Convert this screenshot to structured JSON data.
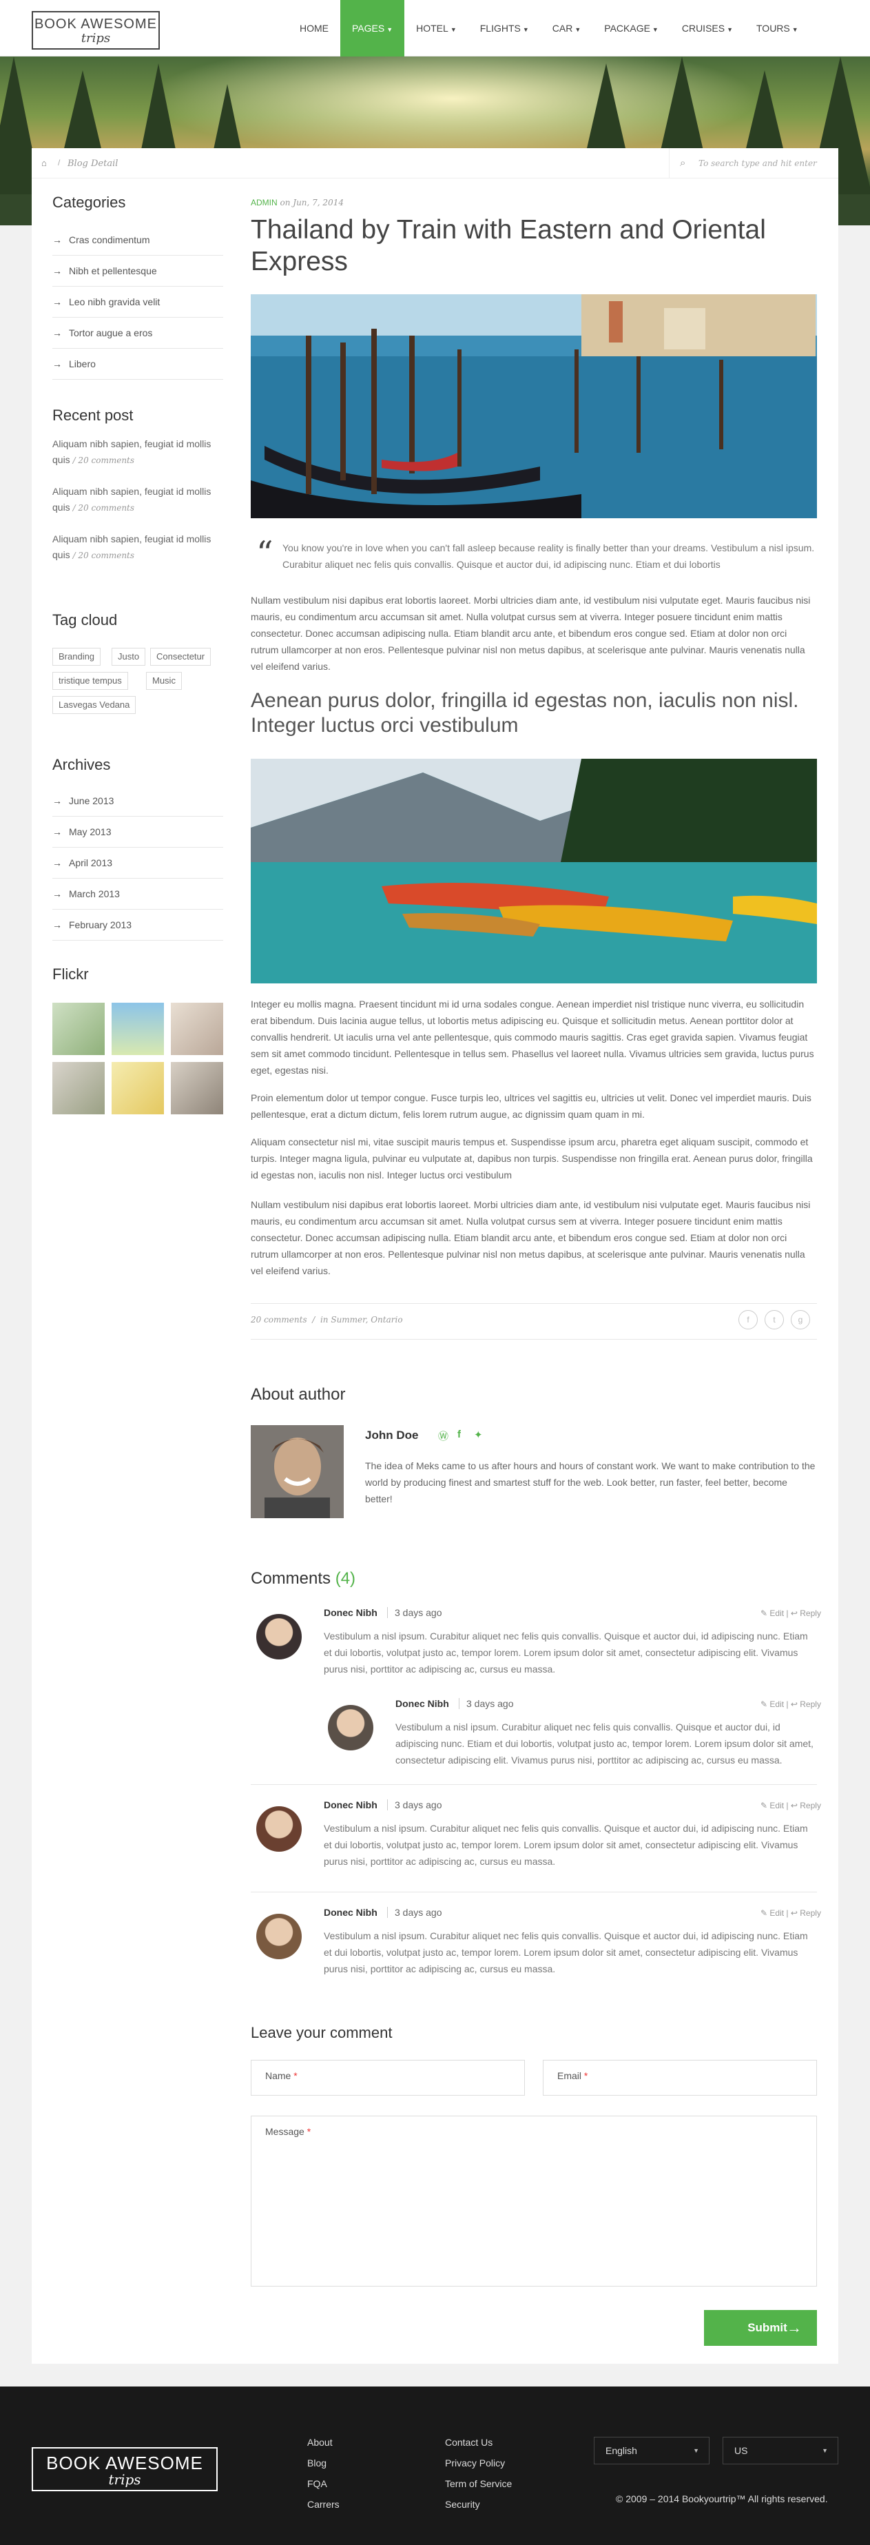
{
  "brand": {
    "line1": "BOOK AWESOME",
    "line2": "trips"
  },
  "nav": [
    {
      "label": "HOME",
      "active": false
    },
    {
      "label": "PAGES",
      "active": true
    },
    {
      "label": "HOTEL",
      "active": false
    },
    {
      "label": "FLIGHTS",
      "active": false
    },
    {
      "label": "CAR",
      "active": false
    },
    {
      "label": "PACKAGE",
      "active": false
    },
    {
      "label": "CRUISES",
      "active": false
    },
    {
      "label": "TOURS",
      "active": false
    }
  ],
  "colors": {
    "accent": "#53b34a",
    "footer_bg": "#191919"
  },
  "breadcrumb": {
    "home_icon": "home-icon",
    "sep": "/",
    "current": "Blog Detail"
  },
  "search": {
    "icon": "search-icon",
    "placeholder": "To search type and hit enter"
  },
  "sidebar": {
    "categories_title": "Categories",
    "categories": [
      "Cras condimentum",
      "Nibh et pellentesque",
      "Leo nibh gravida velit",
      "Tortor augue a eros",
      "Libero"
    ],
    "recent_title": "Recent post",
    "recent": [
      {
        "text": "Aliquam nibh sapien, feugiat id mollis quis",
        "count": "/ 20 comments"
      },
      {
        "text": "Aliquam nibh sapien, feugiat id mollis quis",
        "count": "/ 20 comments"
      },
      {
        "text": "Aliquam nibh sapien, feugiat id mollis quis",
        "count": "/ 20 comments"
      }
    ],
    "tags_title": "Tag cloud",
    "tags": [
      "Branding",
      "Justo",
      "Consectetur",
      "tristique tempus",
      "Music",
      "Lasvegas Vedana"
    ],
    "archives_title": "Archives",
    "archives": [
      "June 2013",
      "May 2013",
      "April 2013",
      "March 2013",
      "February 2013"
    ],
    "flickr_title": "Flickr"
  },
  "post": {
    "author": "ADMIN",
    "date": "on Jun, 7, 2014",
    "title": "Thailand by Train with Eastern and Oriental Express",
    "quote": "You know you're in love when you can't fall asleep because reality is finally better than your dreams. Vestibulum a nisl ipsum. Curabitur aliquet nec felis quis convallis. Quisque et auctor dui, id adipiscing nunc. Etiam et dui lobortis",
    "p1": "Nullam vestibulum nisi dapibus erat lobortis laoreet. Morbi ultricies diam ante, id vestibulum nisi vulputate eget. Mauris faucibus nisi mauris, eu condimentum arcu accumsan sit amet. Nulla volutpat cursus sem at viverra. Integer posuere tincidunt enim mattis consectetur. Donec accumsan adipiscing nulla. Etiam blandit arcu ante, et bibendum eros congue sed. Etiam at dolor non orci rutrum ullamcorper at non eros. Pellentesque pulvinar nisl non metus dapibus, at scelerisque ante pulvinar. Mauris venenatis nulla vel eleifend varius.",
    "subtitle": "Aenean purus dolor, fringilla id egestas non, iaculis non nisl. Integer luctus orci vestibulum",
    "p2": "Integer eu mollis magna. Praesent tincidunt mi id urna sodales congue. Aenean imperdiet nisl tristique nunc viverra, eu sollicitudin erat bibendum. Duis lacinia augue tellus, ut lobortis metus adipiscing eu. Quisque et sollicitudin metus. Aenean porttitor dolor at convallis hendrerit. Ut iaculis urna vel ante pellentesque, quis commodo mauris sagittis. Cras eget gravida sapien. Vivamus feugiat sem sit amet commodo tincidunt. Pellentesque in tellus sem. Phasellus vel laoreet nulla. Vivamus ultricies sem gravida, luctus purus eget, egestas nisi.",
    "p3": "Proin elementum dolor ut tempor congue. Fusce turpis leo, ultrices vel sagittis eu, ultricies ut velit. Donec vel imperdiet mauris. Duis pellentesque, erat a dictum dictum, felis lorem rutrum augue, ac dignissim quam quam in mi.",
    "p4": "Aliquam consectetur nisl mi, vitae suscipit mauris tempus et. Suspendisse ipsum arcu, pharetra eget aliquam suscipit, commodo et turpis. Integer magna ligula, pulvinar eu vulputate at, dapibus non turpis. Suspendisse non fringilla erat. Aenean purus dolor, fringilla id egestas non, iaculis non nisl. Integer luctus orci vestibulum",
    "p5": "Nullam vestibulum nisi dapibus erat lobortis laoreet. Morbi ultricies diam ante, id vestibulum nisi vulputate eget. Mauris faucibus nisi mauris, eu condimentum arcu accumsan sit amet. Nulla volutpat cursus sem at viverra. Integer posuere tincidunt enim mattis consectetur. Donec accumsan adipiscing nulla. Etiam blandit arcu ante, et bibendum eros congue sed. Etiam at dolor non orci rutrum ullamcorper at non eros. Pellentesque pulvinar nisl non metus dapibus, at scelerisque ante pulvinar. Mauris venenatis nulla vel eleifend varius.",
    "footer_comments": "20 comments",
    "footer_sep": "/",
    "footer_in": "in",
    "footer_cats": "Summer, Ontario",
    "share_icons": [
      "facebook-icon",
      "twitter-icon",
      "googleplus-icon"
    ]
  },
  "author_box": {
    "title": "About author",
    "name": "John Doe",
    "icons": [
      "wordpress-icon",
      "facebook-icon",
      "twitter-icon"
    ],
    "bio": "The idea of Meks came to us after hours and hours of constant work. We want to make contribution to the world by producing finest and smartest stuff for the web. Look better, run faster, feel better, become better!"
  },
  "comments": {
    "title": "Comments",
    "count": "(4)",
    "edit": "Edit",
    "reply": "Reply",
    "items": [
      {
        "name": "Donec Nibh",
        "date": "3 days ago",
        "body": "Vestibulum a nisl ipsum. Curabitur aliquet nec felis quis convallis. Quisque et auctor dui, id adipiscing nunc. Etiam et dui lobortis, volutpat justo ac, tempor lorem. Lorem ipsum dolor sit amet, consectetur adipiscing elit. Vivamus purus nisi, porttitor ac adipiscing ac, cursus eu massa."
      },
      {
        "name": "Donec Nibh",
        "date": "3 days ago",
        "body": "Vestibulum a nisl ipsum. Curabitur aliquet nec felis quis convallis. Quisque et auctor dui, id adipiscing nunc. Etiam et dui lobortis, volutpat justo ac, tempor lorem. Lorem ipsum dolor sit amet, consectetur adipiscing elit. Vivamus purus nisi, porttitor ac adipiscing ac, cursus eu massa."
      },
      {
        "name": "Donec Nibh",
        "date": "3 days ago",
        "body": "Vestibulum a nisl ipsum. Curabitur aliquet nec felis quis convallis. Quisque et auctor dui, id adipiscing nunc. Etiam et dui lobortis, volutpat justo ac, tempor lorem. Lorem ipsum dolor sit amet, consectetur adipiscing elit. Vivamus purus nisi, porttitor ac adipiscing ac, cursus eu massa."
      },
      {
        "name": "Donec Nibh",
        "date": "3 days ago",
        "body": "Vestibulum a nisl ipsum. Curabitur aliquet nec felis quis convallis. Quisque et auctor dui, id adipiscing nunc. Etiam et dui lobortis, volutpat justo ac, tempor lorem. Lorem ipsum dolor sit amet, consectetur adipiscing elit. Vivamus purus nisi, porttitor ac adipiscing ac, cursus eu massa."
      }
    ]
  },
  "form": {
    "title": "Leave your comment",
    "name_label": "Name",
    "email_label": "Email",
    "message_label": "Message",
    "required_mark": "*",
    "submit": "Submit"
  },
  "footer": {
    "col1": [
      "About",
      "Blog",
      "FQA",
      "Carrers"
    ],
    "col2": [
      "Contact Us",
      "Privacy Policy",
      "Term of Service",
      "Security"
    ],
    "language": "English",
    "region": "US",
    "copyright": "© 2009 – 2014 Bookyourtrip™ All rights reserved."
  }
}
